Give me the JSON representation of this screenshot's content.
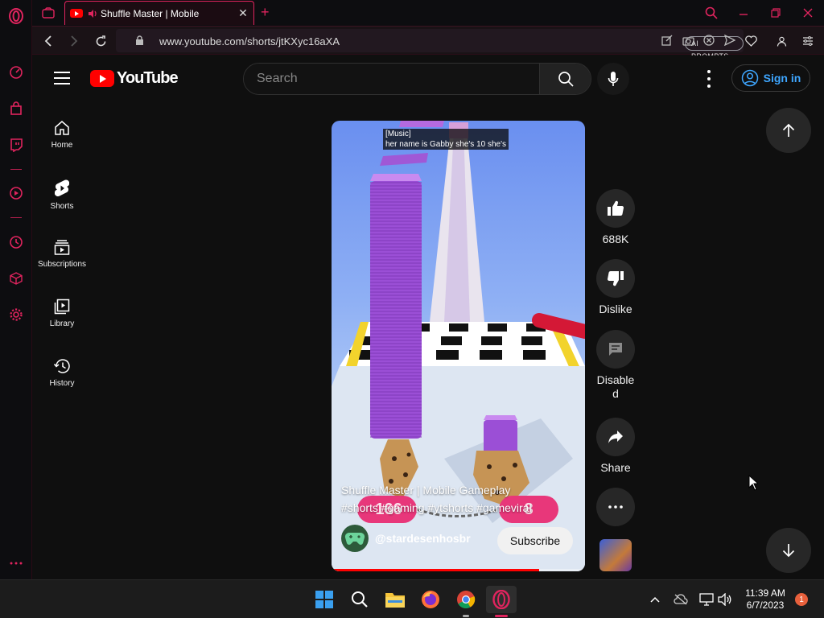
{
  "browser": {
    "tab_title": "Shuffle Master | Mobile",
    "tab_close": "✕",
    "new_tab": "+",
    "url": "www.youtube.com/shorts/jtKXyc16aXA",
    "ai_prompts": "AI PROMPTS",
    "accent": "#e0245e"
  },
  "yt": {
    "logo_text": "YouTube",
    "search_placeholder": "Search",
    "sign_in": "Sign in",
    "guide": [
      {
        "label": "Home",
        "icon": "home-icon"
      },
      {
        "label": "Shorts",
        "icon": "shorts-icon"
      },
      {
        "label": "Subscriptions",
        "icon": "subscriptions-icon"
      },
      {
        "label": "Library",
        "icon": "library-icon"
      },
      {
        "label": "History",
        "icon": "history-icon"
      }
    ]
  },
  "short": {
    "caption_line1": "[Music]",
    "caption_line2": "her name is Gabby she's 10 she's",
    "title_line1": "Shuffle Master | Mobile Gameplay",
    "title_line2": "#shorts #gaming #ytshorts #gameviral",
    "channel": "@stardesenhosbr",
    "subscribe": "Subscribe",
    "progress_fraction": 0.82,
    "game_count_left": "166",
    "game_count_right": "8"
  },
  "actions": {
    "likes": "688K",
    "dislike": "Dislike",
    "comments": "Disabled",
    "share": "Share"
  },
  "taskbar": {
    "time": "11:39 AM",
    "date": "6/7/2023",
    "notifications": "1"
  }
}
